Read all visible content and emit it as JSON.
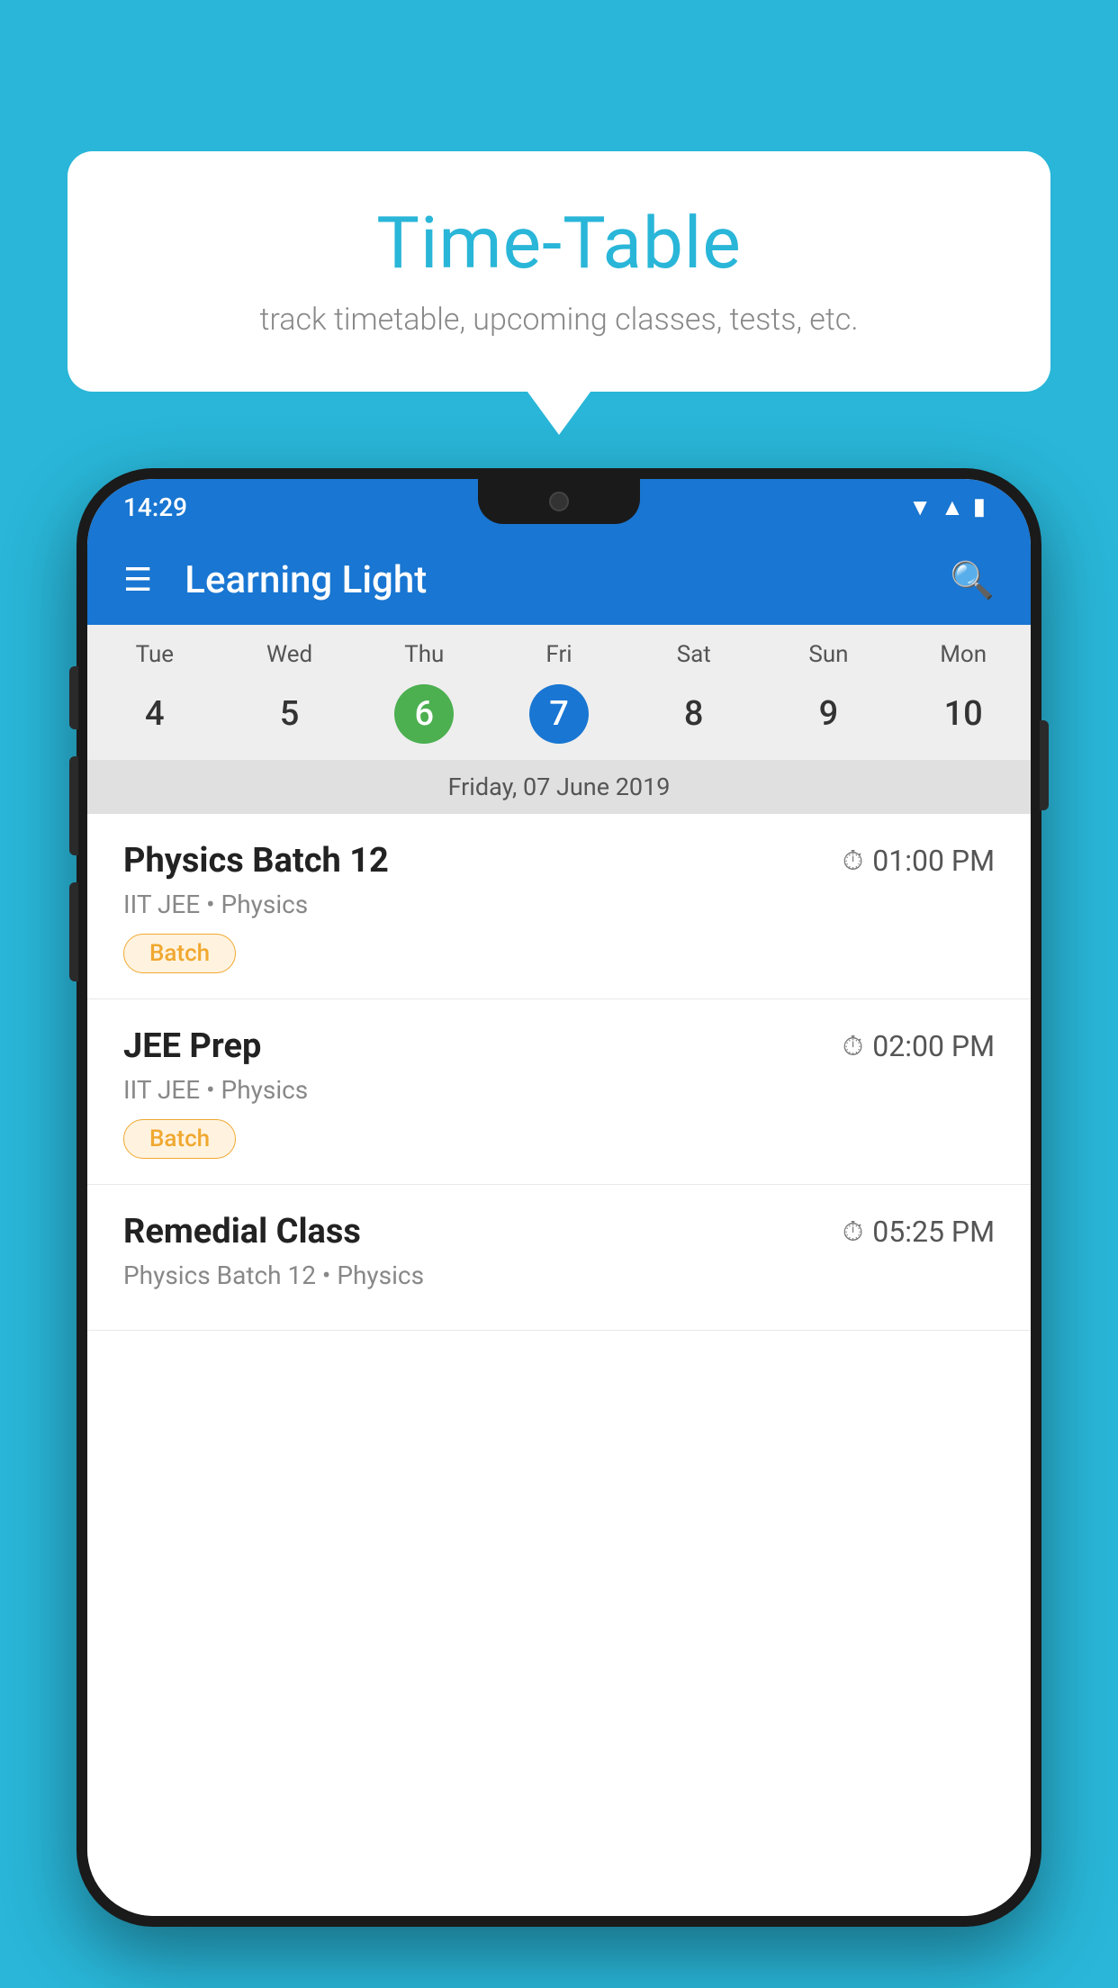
{
  "background_color": "#29b6d8",
  "speech_bubble": {
    "title": "Time-Table",
    "subtitle": "track timetable, upcoming classes, tests, etc."
  },
  "phone": {
    "status_bar": {
      "time": "14:29"
    },
    "app_bar": {
      "title": "Learning Light"
    },
    "calendar": {
      "days": [
        {
          "label": "Tue",
          "number": "4"
        },
        {
          "label": "Wed",
          "number": "5"
        },
        {
          "label": "Thu",
          "number": "6",
          "style": "green"
        },
        {
          "label": "Fri",
          "number": "7",
          "style": "blue"
        },
        {
          "label": "Sat",
          "number": "8"
        },
        {
          "label": "Sun",
          "number": "9"
        },
        {
          "label": "Mon",
          "number": "10"
        }
      ],
      "selected_date": "Friday, 07 June 2019"
    },
    "schedule": [
      {
        "name": "Physics Batch 12",
        "time": "01:00 PM",
        "meta": "IIT JEE • Physics",
        "tag": "Batch"
      },
      {
        "name": "JEE Prep",
        "time": "02:00 PM",
        "meta": "IIT JEE • Physics",
        "tag": "Batch"
      },
      {
        "name": "Remedial Class",
        "time": "05:25 PM",
        "meta": "Physics Batch 12 • Physics",
        "tag": ""
      }
    ]
  }
}
